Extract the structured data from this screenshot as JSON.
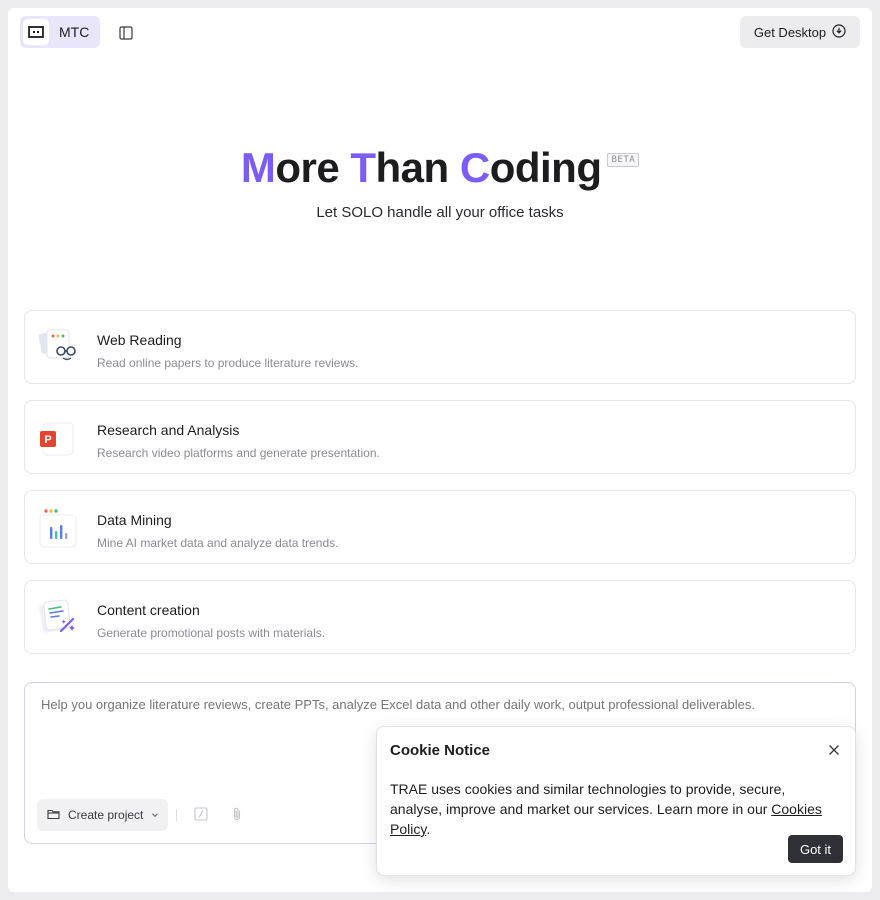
{
  "header": {
    "workspace_label": "MTC",
    "get_desktop_label": "Get Desktop"
  },
  "hero": {
    "title_parts": [
      "M",
      "ore ",
      "T",
      "han ",
      "C",
      "oding"
    ],
    "beta_label": "BETA",
    "subtitle": "Let SOLO handle all your office tasks"
  },
  "cards": [
    {
      "title": "Web Reading",
      "description": "Read online papers to produce literature reviews.",
      "icon": "web-reading-icon"
    },
    {
      "title": "Research and Analysis",
      "description": "Research video platforms and generate presentation.",
      "icon": "presentation-icon"
    },
    {
      "title": "Data Mining",
      "description": "Mine AI market data and analyze data trends.",
      "icon": "data-chart-icon"
    },
    {
      "title": "Content creation",
      "description": "Generate promotional posts with materials.",
      "icon": "content-creation-icon"
    }
  ],
  "composer": {
    "placeholder": "Help you organize literature reviews, create PPTs, analyze Excel data and other daily work, output professional deliverables.",
    "create_project_label": "Create project"
  },
  "cookie": {
    "title": "Cookie Notice",
    "text_before_link": "TRAE uses cookies and similar technologies to provide, secure, analyse, improve and market our services. Learn more in our ",
    "link_text": "Cookies Policy",
    "text_after_link": ".",
    "button_label": "Got it"
  },
  "colors": {
    "accent": "#7b5cf5",
    "ppt_red": "#e0452f",
    "button_dark": "#2f3136"
  }
}
